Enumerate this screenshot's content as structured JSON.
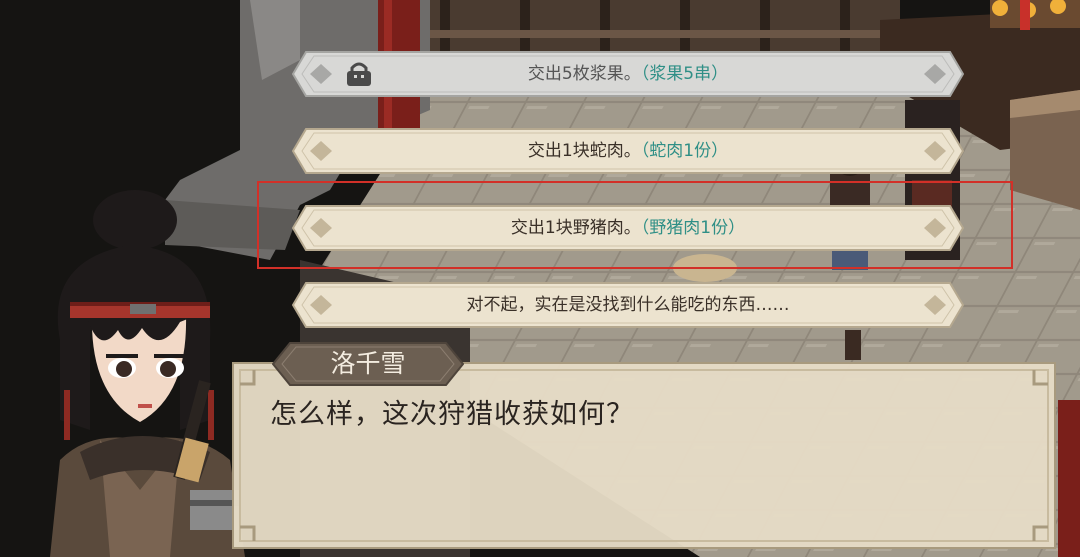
{
  "choices": [
    {
      "text": "交出5枚浆果。",
      "reward": "（浆果5串）",
      "locked": true
    },
    {
      "text": "交出1块蛇肉。",
      "reward": "（蛇肉1份）",
      "locked": false
    },
    {
      "text": "交出1块野猪肉。",
      "reward": "（野猪肉1份）",
      "locked": false,
      "selected": true
    },
    {
      "text": "对不起，实在是没找到什么能吃的东西……",
      "reward": "",
      "locked": false
    }
  ],
  "dialog": {
    "speaker": "洛千雪",
    "line": "怎么样，这次狩猎收获如何？"
  },
  "colors": {
    "choice_fill": "#ece3cf",
    "choice_border": "#b5a88f",
    "reward_text": "#2f8f86",
    "selection_frame": "#d23028",
    "nametag_fill": "#6c5f52"
  },
  "icons": {
    "locked_choice": "lock-icon"
  }
}
